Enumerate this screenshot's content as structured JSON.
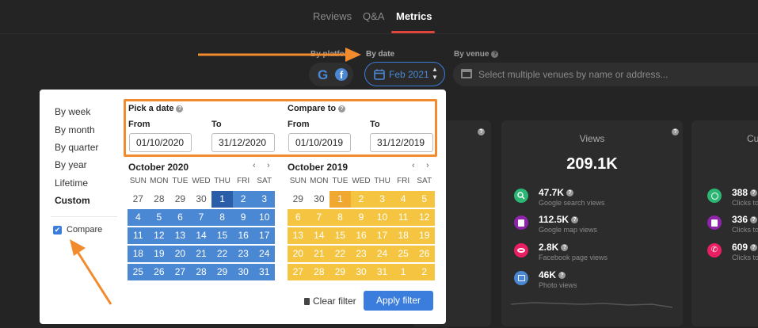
{
  "tabs": [
    {
      "label": "Reviews"
    },
    {
      "label": "Q&A"
    },
    {
      "label": "Metrics"
    }
  ],
  "filters": {
    "platform_label": "By platform",
    "date_label": "By date",
    "venue_label": "By venue",
    "date_value": "Feb 2021",
    "venue_placeholder": "Select multiple venues by name or address..."
  },
  "cards": {
    "views_title": "Views",
    "views_total": "209.1K",
    "third_title_partial": "Cu",
    "stats": [
      {
        "value": "47.7K",
        "label": "Google search views",
        "icon": "search-icon",
        "color": "#2bb673"
      },
      {
        "value": "112.5K",
        "label": "Google map views",
        "icon": "map-icon",
        "color": "#8e24aa"
      },
      {
        "value": "2.8K",
        "label": "Facebook page views",
        "icon": "eye-icon",
        "color": "#e91e63"
      },
      {
        "value": "46K",
        "label": "Photo views",
        "icon": "photo-icon",
        "color": "#4a88d4"
      }
    ],
    "stats2": [
      {
        "value": "388",
        "label": "Clicks to",
        "icon": "globe-icon",
        "color": "#2bb673"
      },
      {
        "value": "336",
        "label": "Clicks to",
        "icon": "map-icon",
        "color": "#8e24aa"
      },
      {
        "value": "609",
        "label": "Clicks to",
        "icon": "phone-icon",
        "color": "#e91e63"
      }
    ]
  },
  "picker": {
    "options": [
      "By week",
      "By month",
      "By quarter",
      "By year",
      "Lifetime",
      "Custom"
    ],
    "compare_label": "Compare",
    "pick_title": "Pick a date",
    "compare_title": "Compare to",
    "from_label": "From",
    "to_label": "To",
    "from1": "01/10/2020",
    "to1": "31/12/2020",
    "from2": "01/10/2019",
    "to2": "31/12/2019",
    "month1": "October 2020",
    "month2": "October 2019",
    "dows": [
      "SUN",
      "MON",
      "TUE",
      "WED",
      "THU",
      "FRI",
      "SAT"
    ],
    "cal1": [
      [
        27,
        28,
        29,
        30,
        1,
        2,
        3
      ],
      [
        4,
        5,
        6,
        7,
        8,
        9,
        10
      ],
      [
        11,
        12,
        13,
        14,
        15,
        16,
        17
      ],
      [
        18,
        19,
        20,
        21,
        22,
        23,
        24
      ],
      [
        25,
        26,
        27,
        28,
        29,
        30,
        31
      ]
    ],
    "cal2": [
      [
        29,
        30,
        1,
        2,
        3,
        4,
        5
      ],
      [
        6,
        7,
        8,
        9,
        10,
        11,
        12
      ],
      [
        13,
        14,
        15,
        16,
        17,
        18,
        19
      ],
      [
        20,
        21,
        22,
        23,
        24,
        25,
        26
      ],
      [
        27,
        28,
        29,
        30,
        31,
        1,
        2
      ]
    ],
    "clear_label": "Clear filter",
    "apply_label": "Apply filter"
  },
  "colors": {
    "accent": "#3b7ddd",
    "compare": "#f5c542",
    "annotation": "#f28a2e"
  }
}
